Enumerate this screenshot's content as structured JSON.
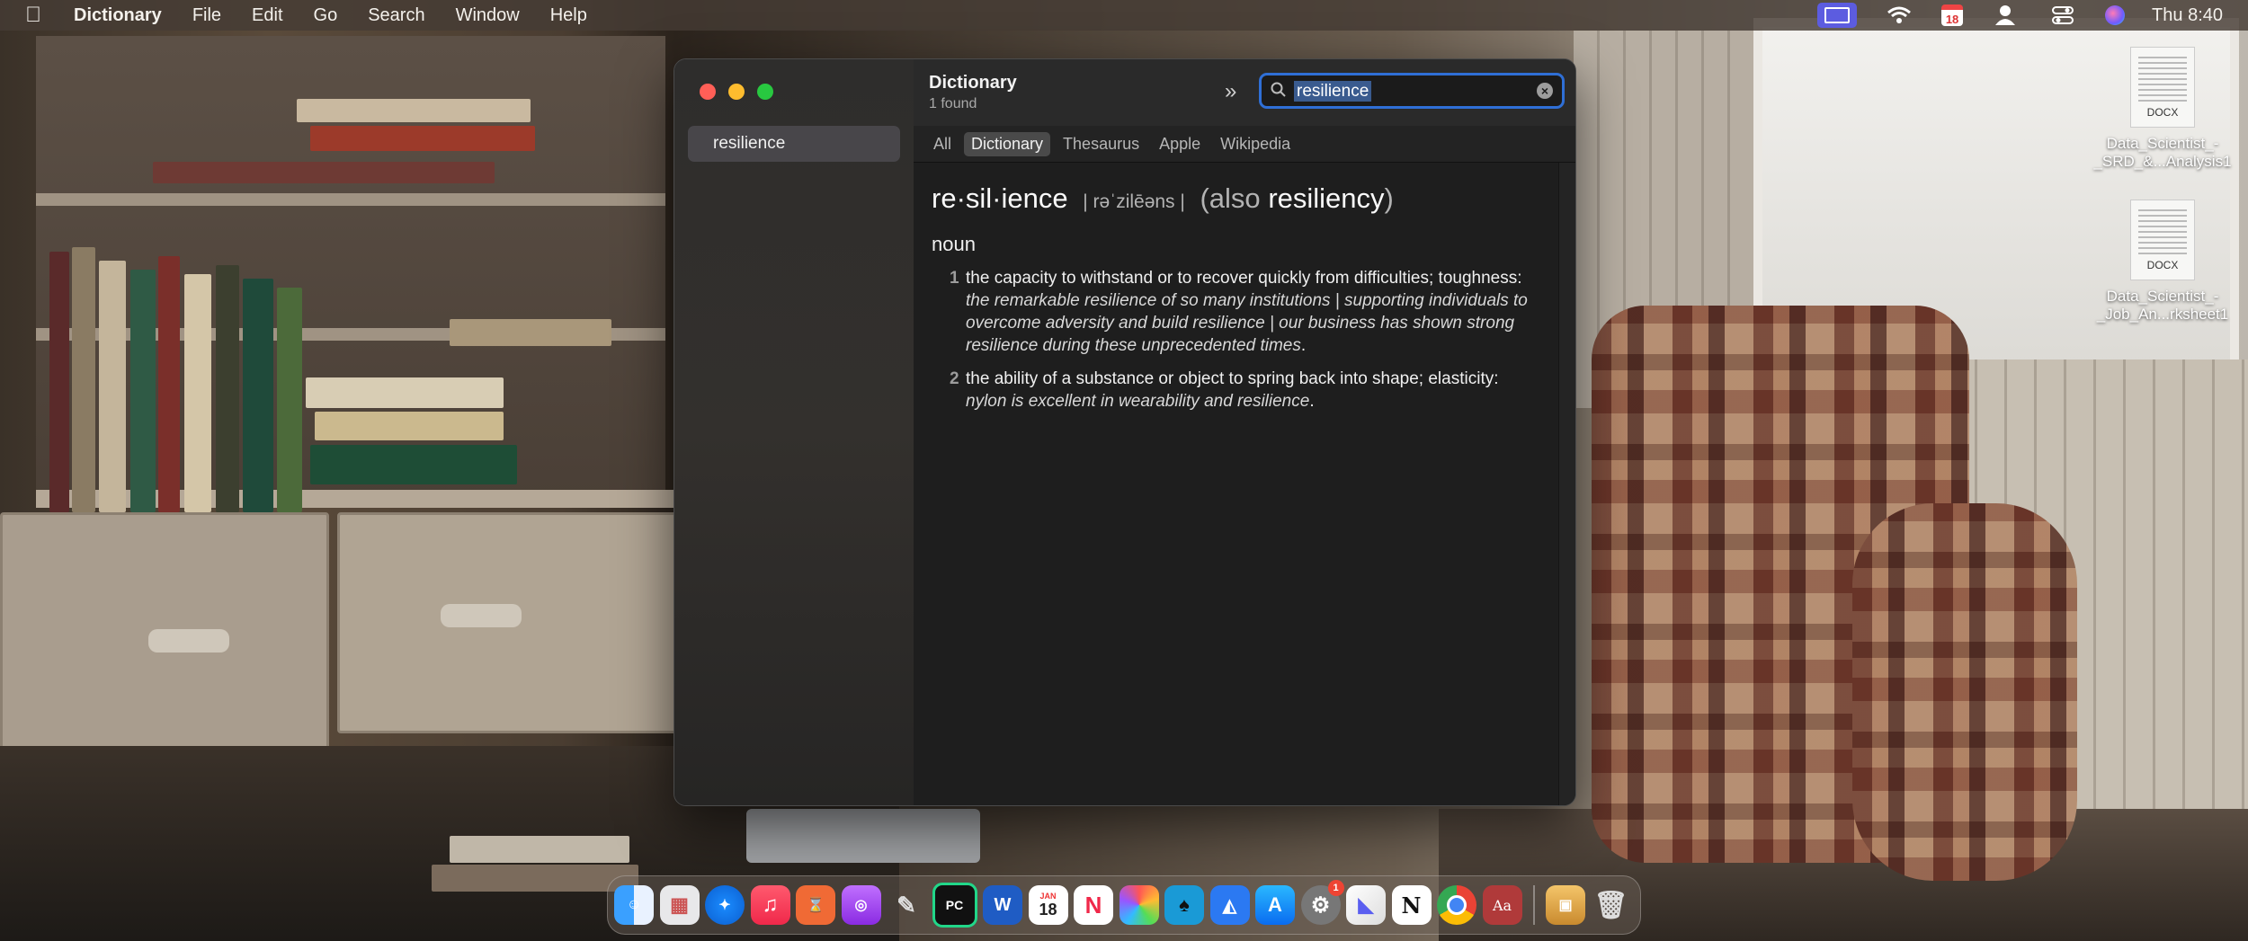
{
  "menubar": {
    "apple_icon": "apple-logo",
    "app_name": "Dictionary",
    "menus": [
      "File",
      "Edit",
      "Go",
      "Search",
      "Window",
      "Help"
    ],
    "calendar_day": "18",
    "clock": "Thu 8:40"
  },
  "desktop_files": [
    {
      "type": "DOCX",
      "name_line1": "Data_Scientist_-",
      "name_line2": "_SRD_&...Analysis1"
    },
    {
      "type": "DOCX",
      "name_line1": "Data_Scientist_-",
      "name_line2": "_Job_An...rksheet1"
    }
  ],
  "dictionary": {
    "sidebar_results": [
      "resilience"
    ],
    "toolbar_title": "Dictionary",
    "toolbar_subtitle": "1 found",
    "search_value": "resilience",
    "tabs": [
      "All",
      "Dictionary",
      "Thesaurus",
      "Apple",
      "Wikipedia"
    ],
    "active_tab": "Dictionary",
    "entry": {
      "headword": "re·sil·ience",
      "pronunciation": "| rəˈzilēəns |",
      "also_open": "(also",
      "also_word": "resiliency",
      "also_close": ")",
      "part_of_speech": "noun",
      "senses": [
        {
          "number": "1",
          "definition": "the capacity to withstand or to recover quickly from difficulties; toughness:",
          "example": "the remarkable resilience of so many institutions | supporting individuals to overcome adversity and build resilience | our business has shown strong resilience during these unprecedented times",
          "end": "."
        },
        {
          "number": "2",
          "definition": "the ability of a substance or object to spring back into shape; elasticity:",
          "example": "nylon is excellent in wearability and resilience",
          "end": "."
        }
      ]
    }
  },
  "dock": {
    "apps": [
      "Finder",
      "Launchpad",
      "Safari",
      "Music",
      "Screen Time",
      "Podcasts",
      "Script Editor",
      "PyCharm",
      "Microsoft Word",
      "Calendar",
      "News",
      "Photos",
      "Kindle",
      "Keynote",
      "App Store",
      "System Settings",
      "Toolbox",
      "Notion",
      "Google Chrome",
      "Dictionary",
      "Archive Utility",
      "Trash"
    ],
    "calendar_month": "JAN",
    "calendar_day": "18",
    "settings_badge": "1"
  },
  "colors": {
    "accent": "#2f6fd6",
    "close": "#ff5f57",
    "minimize": "#febc2e",
    "zoom": "#28c840"
  }
}
